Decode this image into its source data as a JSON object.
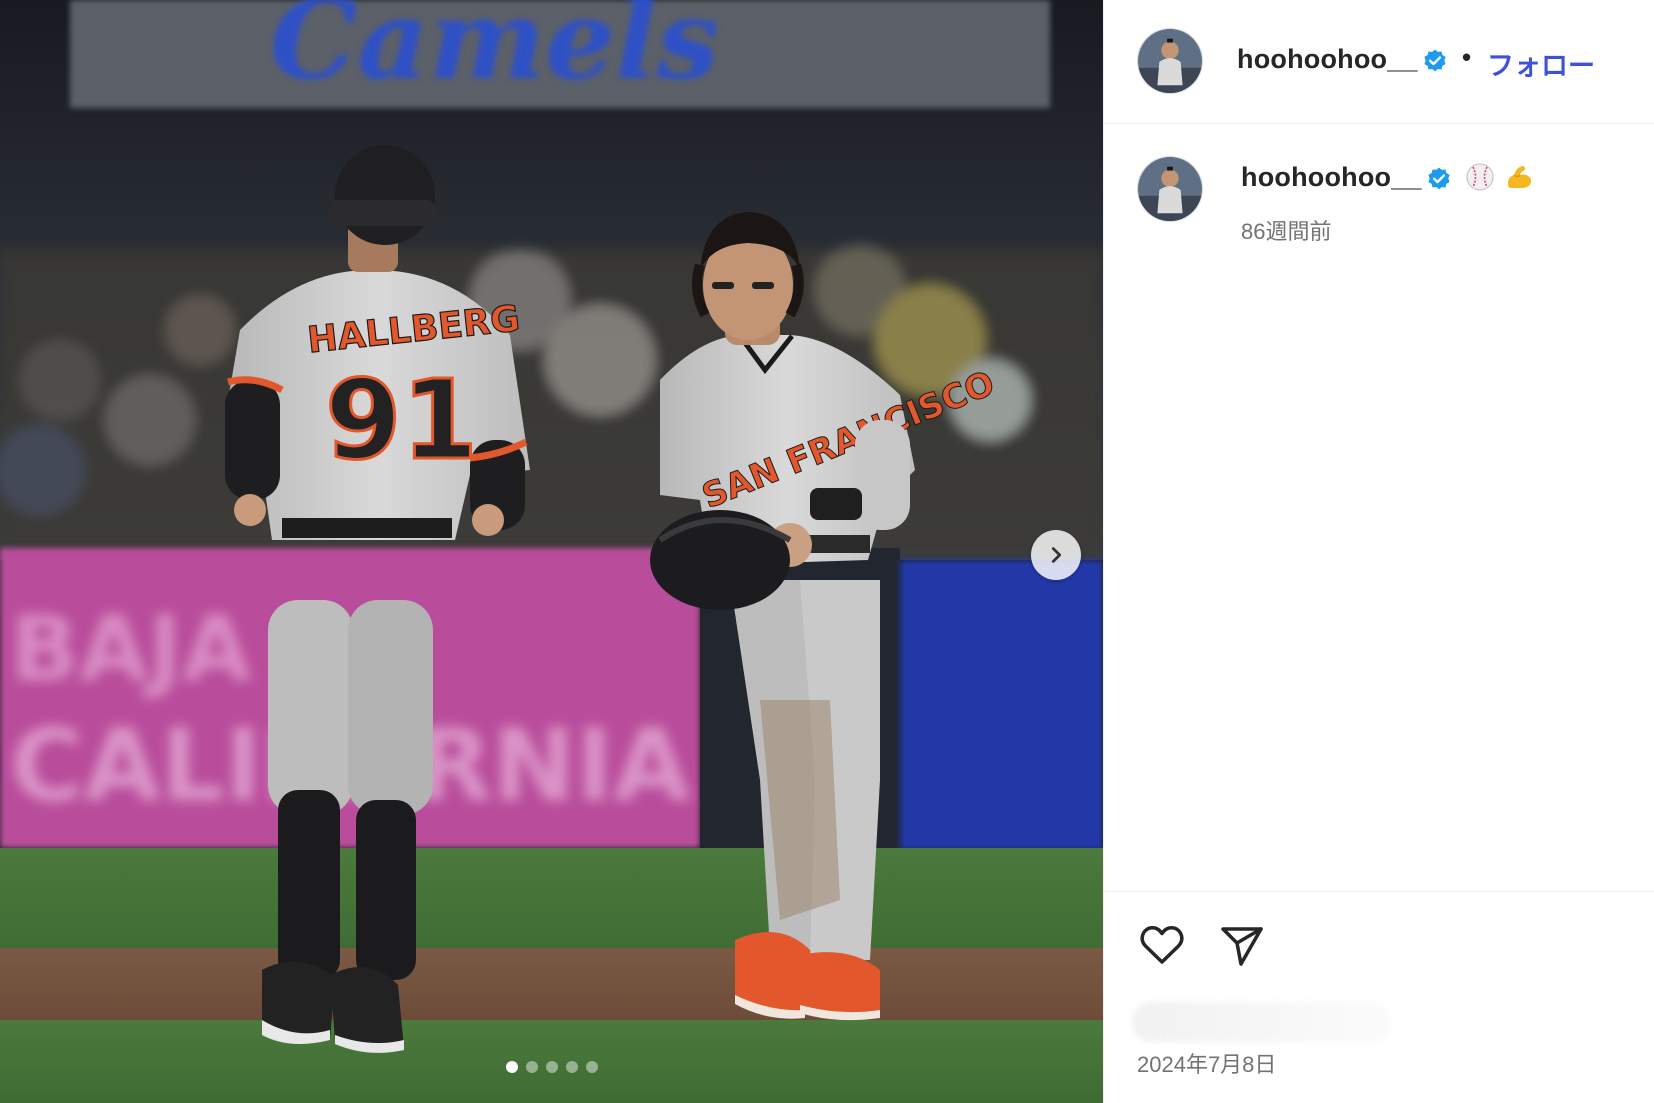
{
  "post": {
    "media": {
      "carousel": {
        "total": 5,
        "active_index": 0
      },
      "next_label": "Next"
    },
    "header": {
      "username": "hoohoohoo__",
      "follow_label": "フォロー",
      "separator": "•"
    },
    "caption": {
      "username": "hoohoohoo__",
      "emojis": [
        "baseball-emoji",
        "flexed-biceps-emoji"
      ],
      "relative_time": "86週間前"
    },
    "actions": {
      "like_icon": "heart-icon",
      "share_icon": "paper-plane-icon"
    },
    "date": "2024年7月8日"
  },
  "colors": {
    "follow_blue": "#3f51d8",
    "verified_blue": "#1d9bf0",
    "muted_text": "#737373",
    "giants_orange": "#e2572b"
  }
}
